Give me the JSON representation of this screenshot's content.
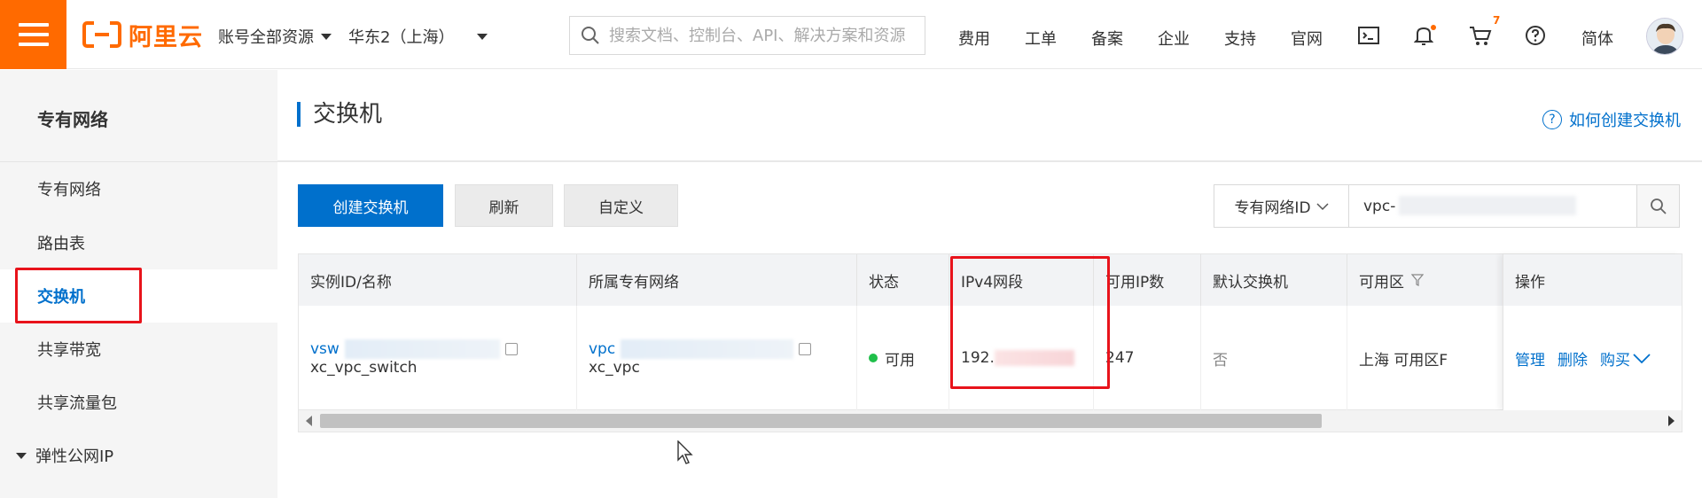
{
  "header": {
    "logo_text": "阿里云",
    "account_resources": "账号全部资源",
    "region": "华东2（上海）",
    "search_placeholder": "搜索文档、控制台、API、解决方案和资源",
    "nav": [
      "费用",
      "工单",
      "备案",
      "企业",
      "支持",
      "官网"
    ],
    "cart_badge": "7",
    "lang": "简体",
    "accent": "#ff6a00"
  },
  "sidebar": {
    "title": "专有网络",
    "items": [
      {
        "label": "专有网络"
      },
      {
        "label": "路由表"
      },
      {
        "label": "交换机",
        "active": true
      },
      {
        "label": "共享带宽"
      },
      {
        "label": "共享流量包"
      },
      {
        "label": "弹性公网IP",
        "expandable": true
      }
    ]
  },
  "page": {
    "title": "交换机",
    "help_link": "如何创建交换机"
  },
  "toolbar": {
    "create": "创建交换机",
    "refresh": "刷新",
    "customize": "自定义"
  },
  "filter": {
    "field": "专有网络ID",
    "value": "vpc-"
  },
  "table": {
    "columns": [
      "实例ID/名称",
      "所属专有网络",
      "状态",
      "IPv4网段",
      "可用IP数",
      "默认交换机",
      "可用区",
      "操作"
    ],
    "rows": [
      {
        "id": "vsw",
        "name": "xc_vpc_switch",
        "vpc_id": "vpc",
        "vpc_name": "xc_vpc",
        "status": "可用",
        "ipv4": "192.",
        "available_ips": "247",
        "default": "否",
        "zone": "上海 可用区F",
        "actions": [
          "管理",
          "删除",
          "购买"
        ]
      }
    ]
  },
  "colors": {
    "primary": "#0070cc",
    "highlight_box": "#e8131b",
    "status_ok": "#1fbf4a"
  }
}
